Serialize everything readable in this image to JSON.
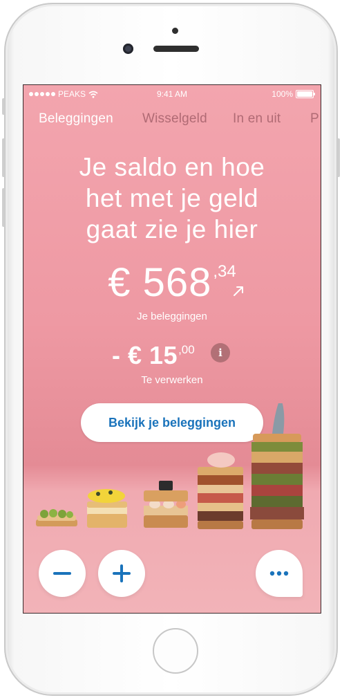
{
  "status": {
    "carrier": "PEAKS",
    "time": "9:41 AM",
    "battery": "100%"
  },
  "tabs": [
    {
      "label": "Beleggingen",
      "active": true
    },
    {
      "label": "Wisselgeld",
      "active": false
    },
    {
      "label": "In en uit",
      "active": false
    },
    {
      "label": "P",
      "active": false
    }
  ],
  "headline": {
    "line1": "Je saldo en hoe",
    "line2": "het met je geld",
    "line3": "gaat zie je hier"
  },
  "balance": {
    "main": "€ 568",
    "cents": ",34",
    "label": "Je beleggingen",
    "trend_icon": "arrow-up-right-icon"
  },
  "pending": {
    "main": "- € 15",
    "cents": ",00",
    "label": "Te verwerken",
    "info_icon_text": "i"
  },
  "cta": {
    "label": "Bekijk je beleggingen"
  },
  "actions": {
    "minus_icon": "minus-icon",
    "plus_icon": "plus-icon",
    "more_icon": "more-dots-icon"
  },
  "colors": {
    "accent": "#1a73bb",
    "background": "#ee99a3",
    "inactive_tab": "#b06a74"
  }
}
